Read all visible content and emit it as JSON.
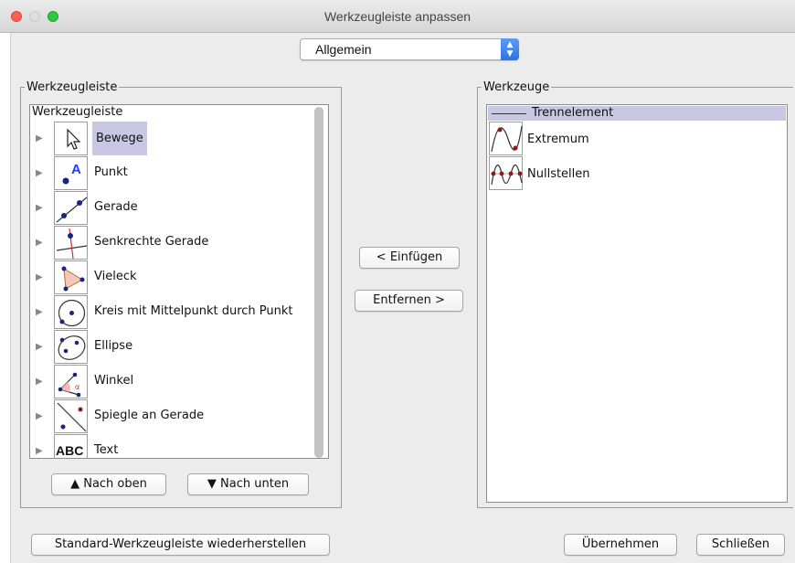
{
  "window": {
    "title": "Werkzeugleiste anpassen"
  },
  "colors": {
    "close": "#fc5f57",
    "minimize": "#dedede",
    "zoom": "#2bc840",
    "selection": "#c8c8e4"
  },
  "toolbar_select": {
    "value": "Allgemein"
  },
  "left_panel": {
    "legend": "Werkzeugleiste",
    "tree_header": "Werkzeugleiste",
    "items": [
      {
        "label": "Bewege",
        "icon": "move-cursor-icon",
        "selected": true
      },
      {
        "label": "Punkt",
        "icon": "point-icon"
      },
      {
        "label": "Gerade",
        "icon": "line-icon"
      },
      {
        "label": "Senkrechte Gerade",
        "icon": "perpendicular-line-icon"
      },
      {
        "label": "Vieleck",
        "icon": "polygon-icon"
      },
      {
        "label": "Kreis mit Mittelpunkt durch Punkt",
        "icon": "circle-icon"
      },
      {
        "label": "Ellipse",
        "icon": "ellipse-icon"
      },
      {
        "label": "Winkel",
        "icon": "angle-icon"
      },
      {
        "label": "Spiegle an Gerade",
        "icon": "reflect-line-icon"
      },
      {
        "label": "Text",
        "icon": "text-icon",
        "icon_text": "ABC"
      }
    ],
    "up_button": "▲ Nach oben",
    "down_button": "▼ Nach unten"
  },
  "middle": {
    "insert_button": "< Einfügen",
    "remove_button": "Entfernen >"
  },
  "right_panel": {
    "legend": "Werkzeuge",
    "separator_label": "Trennelement",
    "items": [
      {
        "label": "Extremum",
        "icon": "extremum-icon"
      },
      {
        "label": "Nullstellen",
        "icon": "roots-icon"
      }
    ]
  },
  "footer": {
    "restore_button": "Standard-Werkzeugleiste wiederherstellen",
    "apply_button": "Übernehmen",
    "close_button": "Schließen"
  }
}
